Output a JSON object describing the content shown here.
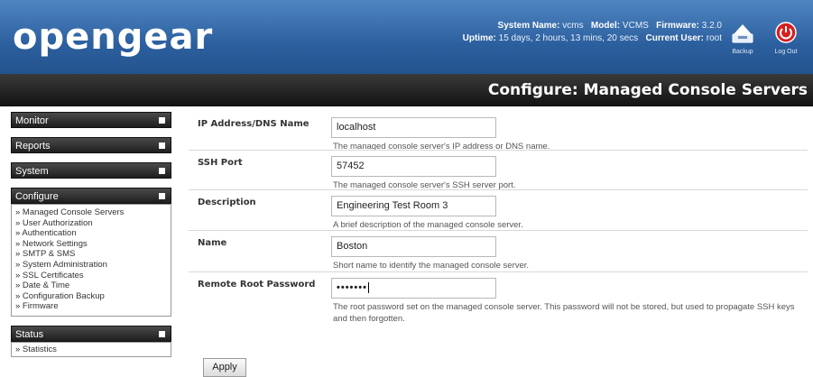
{
  "header": {
    "logo": "opengear",
    "system_name_label": "System Name:",
    "system_name": "vcms",
    "model_label": "Model:",
    "model": "VCMS",
    "firmware_label": "Firmware:",
    "firmware": "3.2.0",
    "uptime_label": "Uptime:",
    "uptime": "15 days, 2 hours, 13 mins, 20 secs",
    "current_user_label": "Current User:",
    "current_user": "root",
    "backup_label": "Backup",
    "logout_label": "Log Out",
    "backup_icon": "backup-icon",
    "logout_icon": "power-icon"
  },
  "page_title": "Configure: Managed Console Servers",
  "sidebar": {
    "monitor": "Monitor",
    "reports": "Reports",
    "system": "System",
    "configure": "Configure",
    "configure_items": [
      "» Managed Console Servers",
      "» User Authorization",
      "» Authentication",
      "» Network Settings",
      "» SMTP & SMS",
      "» System Administration",
      "» SSL Certificates",
      "» Date & Time",
      "» Configuration Backup",
      "» Firmware"
    ],
    "status": "Status",
    "status_items": [
      "» Statistics"
    ]
  },
  "form": {
    "ip": {
      "label": "IP Address/DNS Name",
      "value": "localhost",
      "help": "The managed console server's IP address or DNS name."
    },
    "ssh_port": {
      "label": "SSH Port",
      "value": "57452",
      "help": "The managed console server's SSH server port."
    },
    "description": {
      "label": "Description",
      "value": "Engineering Test Room 3",
      "help": "A brief description of the managed console server."
    },
    "name": {
      "label": "Name",
      "value": "Boston",
      "help": "Short name to identify the managed console server."
    },
    "password": {
      "label": "Remote Root Password",
      "value": "•••••••",
      "help": "The root password set on the managed console server. This password will not be stored, but used to propagate SSH keys and then forgotten."
    }
  },
  "apply_label": "Apply",
  "colors": {
    "header_blue": "#2c5f9e",
    "logout_red": "#d61f1f",
    "titlebar_black": "#111111"
  }
}
